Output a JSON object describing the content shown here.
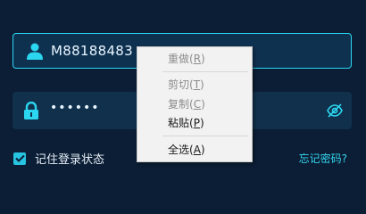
{
  "login": {
    "username": {
      "value": "M88188483",
      "icon": "user-icon"
    },
    "password": {
      "masked_value": "••••••",
      "lock_icon": "lock-icon",
      "toggle_icon": "eye-slash-icon"
    },
    "remember": {
      "label": "记住登录状态",
      "checked": true
    },
    "forgot_link": "忘记密码?"
  },
  "context_menu": {
    "items": [
      {
        "label": "重做",
        "key": "R",
        "enabled": false
      },
      {
        "label": "剪切",
        "key": "T",
        "enabled": false
      },
      {
        "label": "复制",
        "key": "C",
        "enabled": false
      },
      {
        "label": "粘贴",
        "key": "P",
        "enabled": true
      },
      {
        "label": "全选",
        "key": "A",
        "enabled": true
      }
    ]
  },
  "colors": {
    "background": "#0b1e35",
    "field": "#0f3150",
    "accent": "#2bd6f0",
    "link": "#36d6ef"
  }
}
